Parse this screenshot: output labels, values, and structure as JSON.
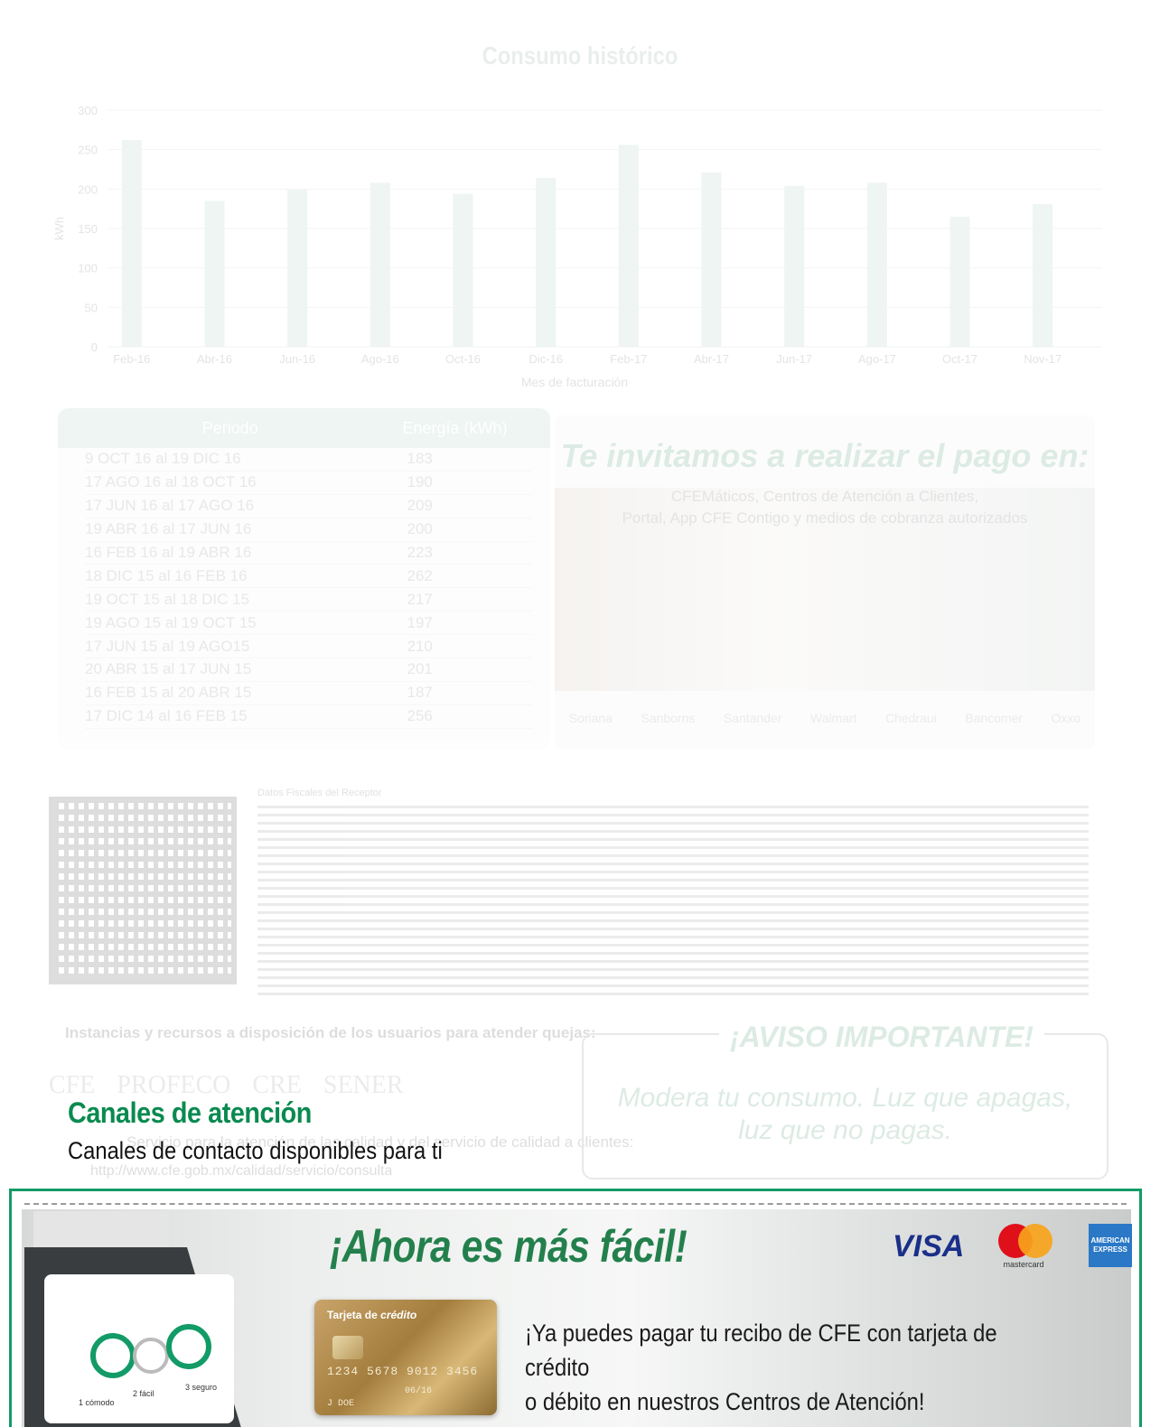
{
  "history_chart": {
    "title": "Consumo histórico",
    "chart_data": {
      "type": "bar",
      "categories": [
        "Feb-16",
        "Abr-16",
        "Jun-16",
        "Ago-16",
        "Oct-16",
        "Dic-16",
        "Feb-17",
        "Abr-17",
        "Jun-17",
        "Ago-17",
        "Oct-17",
        "Nov-17"
      ],
      "values": [
        262,
        185,
        199,
        208,
        194,
        214,
        256,
        221,
        204,
        208,
        165,
        181
      ],
      "ylim": [
        0,
        300
      ],
      "yticks": [
        "0",
        "50",
        "100",
        "150",
        "200",
        "250",
        "300"
      ],
      "ylabel": "kWh",
      "xlabel": "Mes de facturación",
      "grid": true,
      "color": "#9cc7b4"
    }
  },
  "history_table": {
    "headers": [
      "Periodo",
      "Energía (kWh)"
    ],
    "rows": [
      [
        "9 OCT 16 al 19 DIC 16",
        "183"
      ],
      [
        "17 AGO 16 al 18 OCT 16",
        "190"
      ],
      [
        "17 JUN 16 al 17 AGO 16",
        "209"
      ],
      [
        "19 ABR 16 al 17 JUN 16",
        "200"
      ],
      [
        "16 FEB 16 al 19 ABR 16",
        "223"
      ],
      [
        "18 DIC 15 al 16 FEB 16",
        "262"
      ],
      [
        "19 OCT 15 al 18 DIC 15",
        "217"
      ],
      [
        "19 AGO 15 al 19 OCT 15",
        "197"
      ],
      [
        "17 JUN 15 al 19 AGO15",
        "210"
      ],
      [
        "20 ABR 15 al 17 JUN 15",
        "201"
      ],
      [
        "16 FEB 15 al 20 ABR 15",
        "187"
      ],
      [
        "17 DIC 14 al 16 FEB 15",
        "256"
      ]
    ]
  },
  "invite": {
    "title": "Te invitamos a realizar el pago en:",
    "line1": "CFEMáticos, Centros de Atención a Clientes,",
    "line2": "Portal, App CFE Contigo y medios de cobranza autorizados",
    "logos": [
      "Soriana",
      "Sanborns",
      "Santander",
      "Walmart",
      "Chedraui",
      "Bancomer",
      "Oxxo"
    ]
  },
  "fiscal": {
    "label": "Datos Fiscales del Receptor"
  },
  "instancias": {
    "title": "Instancias y recursos a disposición de los usuarios para atender quejas:",
    "logos": [
      "CFE",
      "PROFECO",
      "CRE",
      "SENER"
    ],
    "servicio": "Servicio para la atención de las calidad y del servicio de calidad a clientes:",
    "url": "http://www.cfe.gob.mx/calidad/servicio/consulta"
  },
  "aviso": {
    "title": "¡AVISO IMPORTANTE!",
    "line1": "Modera tu consumo. Luz que apagas,",
    "line2": "luz que no pagas."
  },
  "canales": {
    "title": "Canales de atención",
    "subtitle": "Canales de contacto disponibles para ti"
  },
  "promo": {
    "title": "¡Ahora es más fácil!",
    "text_line1": "¡Ya puedes pagar tu recibo de CFE con tarjeta de crédito",
    "text_line2": "o débito en nuestros Centros de Atención!",
    "card": {
      "label_prefix": "Tarjeta de ",
      "label_emph": "crédito",
      "number": "1234 5678 9012 3456",
      "expiry": "06/16",
      "name": "J DOE"
    },
    "terminal_steps": [
      "1 cómodo",
      "2 fácil",
      "3 seguro"
    ],
    "brands": {
      "visa": "VISA",
      "mastercard": "mastercard",
      "amex": "AMERICAN EXPRESS"
    },
    "accent_color": "#129b66"
  }
}
